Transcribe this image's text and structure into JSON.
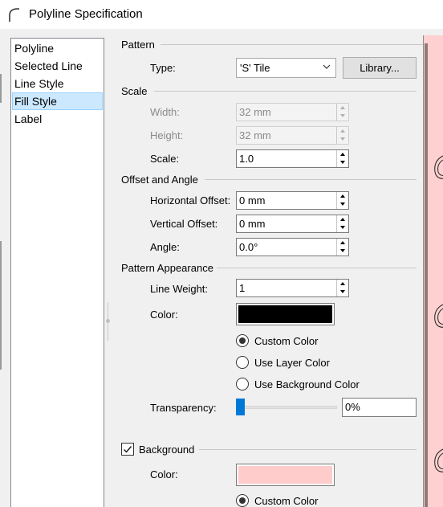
{
  "window": {
    "title": "Polyline Specification",
    "icon": "polyline-arc-icon"
  },
  "nav": {
    "items": [
      {
        "label": "Polyline",
        "selected": false
      },
      {
        "label": "Selected Line",
        "selected": false
      },
      {
        "label": "Line Style",
        "selected": false
      },
      {
        "label": "Fill Style",
        "selected": true
      },
      {
        "label": "Label",
        "selected": false
      }
    ]
  },
  "pattern": {
    "group_title": "Pattern",
    "type_label": "Type:",
    "type_value": "'S' Tile",
    "library_button": "Library..."
  },
  "scale": {
    "group_title": "Scale",
    "width_label": "Width:",
    "width_value": "32 mm",
    "height_label": "Height:",
    "height_value": "32 mm",
    "scale_label": "Scale:",
    "scale_value": "1.0"
  },
  "offset": {
    "group_title": "Offset and Angle",
    "h_label": "Horizontal Offset:",
    "h_value": "0 mm",
    "v_label": "Vertical Offset:",
    "v_value": "0 mm",
    "angle_label": "Angle:",
    "angle_value": "0.0°"
  },
  "appearance": {
    "group_title": "Pattern Appearance",
    "weight_label": "Line Weight:",
    "weight_value": "1",
    "color_label": "Color:",
    "color_value": "#000000",
    "radio_custom": "Custom Color",
    "radio_layer": "Use Layer Color",
    "radio_background": "Use Background Color",
    "selected_radio": "custom",
    "transparency_label": "Transparency:",
    "transparency_value": "0%",
    "transparency_level": 0
  },
  "background": {
    "check_label": "Background",
    "checked": true,
    "color_label": "Color:",
    "color_value": "#ffcccc",
    "radio_custom": "Custom Color"
  },
  "colors": {
    "selection": "#cce8ff",
    "accent": "#0078d7",
    "preview_fill": "#ffd0d0"
  }
}
